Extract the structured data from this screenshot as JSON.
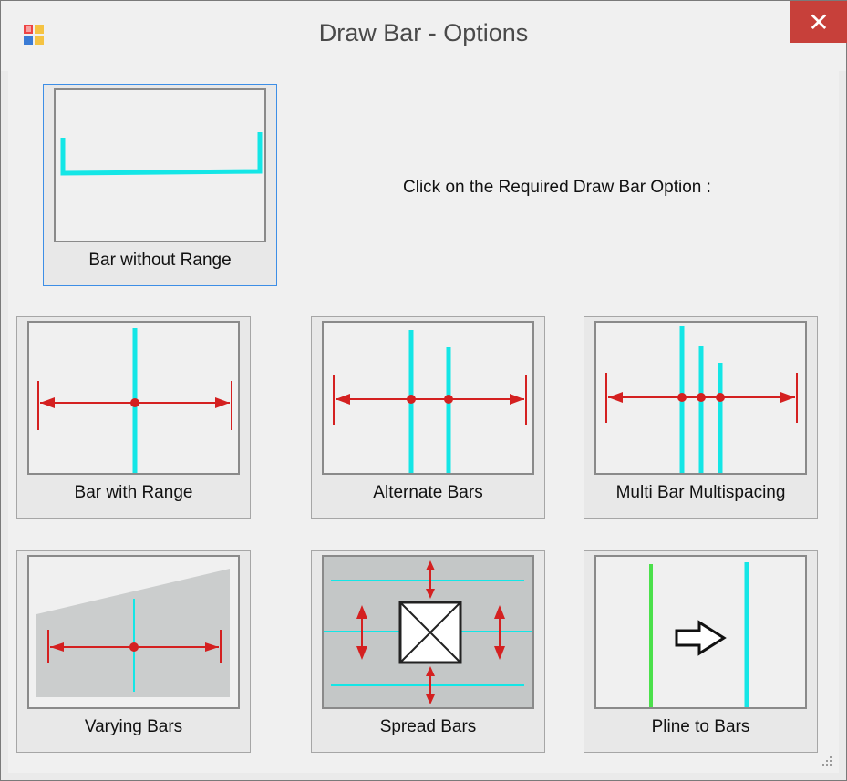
{
  "window": {
    "title": "Draw Bar - Options",
    "close_glyph": "✕"
  },
  "prompt": "Click on the Required Draw Bar Option :",
  "options": [
    {
      "label": "Bar without Range"
    },
    {
      "label": "Bar with Range"
    },
    {
      "label": "Alternate Bars"
    },
    {
      "label": "Multi Bar Multispacing"
    },
    {
      "label": "Varying Bars"
    },
    {
      "label": "Spread Bars"
    },
    {
      "label": "Pline to Bars"
    }
  ],
  "icons": {
    "app": "app-icon",
    "close": "close-icon",
    "resize": "resize-grip-icon"
  },
  "colors": {
    "bar": "#14e6e6",
    "range": "#d42020",
    "pline": "#4be04b",
    "selection": "#3d8ee6",
    "close": "#c7403a"
  }
}
